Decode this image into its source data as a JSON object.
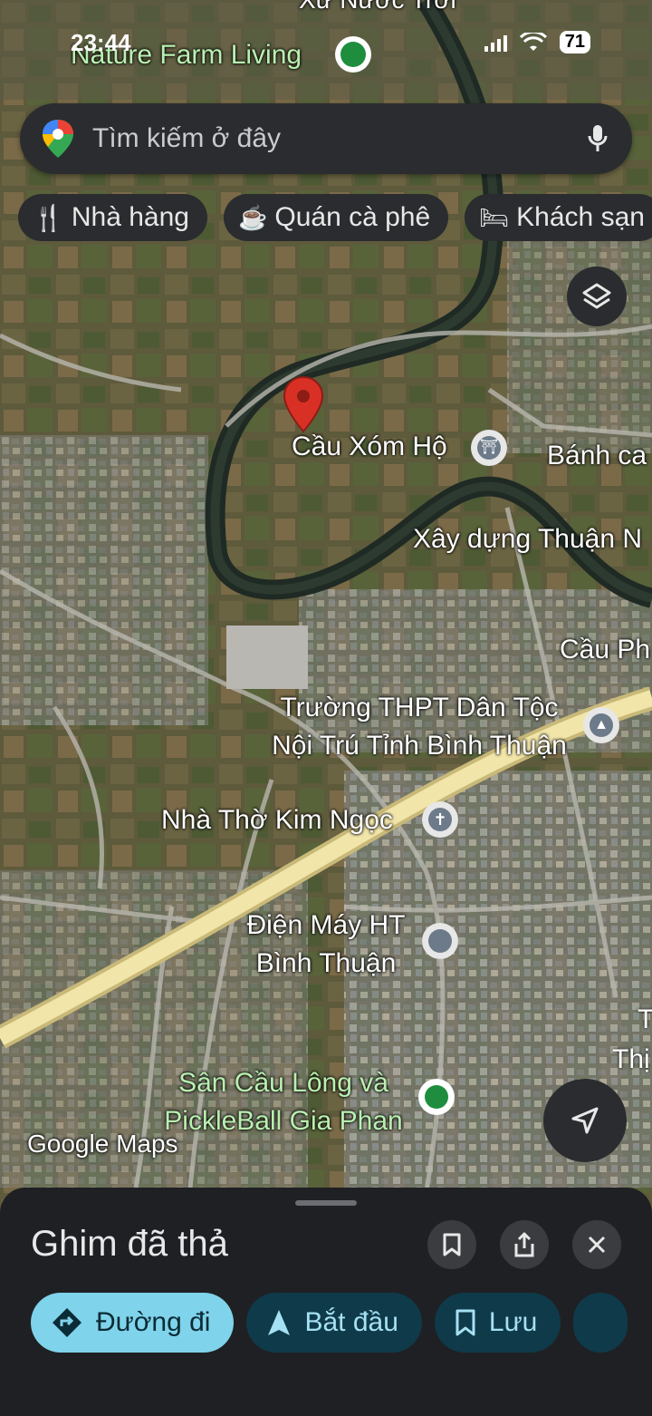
{
  "status_bar": {
    "time": "23:44",
    "battery": "71"
  },
  "search": {
    "placeholder": "Tìm kiếm ở đây"
  },
  "chips": [
    {
      "label": "Nhà hàng",
      "icon": "fork-knife-icon"
    },
    {
      "label": "Quán cà phê",
      "icon": "coffee-cup-icon"
    },
    {
      "label": "Khách sạn",
      "icon": "bed-icon"
    }
  ],
  "map": {
    "labels": {
      "nature_farm": "Nature Farm Living",
      "xu_nuoc_troi": "Xứ Nước Trời",
      "cau_xom_ho": "Cầu Xóm Hộ",
      "banh_ca": "Bánh ca",
      "xay_dung": "Xây dựng Thuận N",
      "cau_ph": "Cầu Ph",
      "truong_1": "Trường THPT Dân Tộc",
      "truong_2": "Nội Trú Tỉnh Bình Thuận",
      "nha_tho": "Nhà Thờ Kim Ngọc",
      "dien_may_1": "Điện Máy HT",
      "dien_may_2": "Bình Thuận",
      "t": "T",
      "thi": "Thị",
      "san_cau_1": "Sân Cầu Lông và",
      "san_cau_2": "PickleBall Gia Phan",
      "watermark": "Google Maps"
    },
    "colors": {
      "accent": "#7fd3ea",
      "pin": "#d93025"
    }
  },
  "sheet": {
    "title": "Ghim đã thả",
    "actions": {
      "directions": "Đường đi",
      "start": "Bắt đầu",
      "save": "Lưu"
    }
  }
}
